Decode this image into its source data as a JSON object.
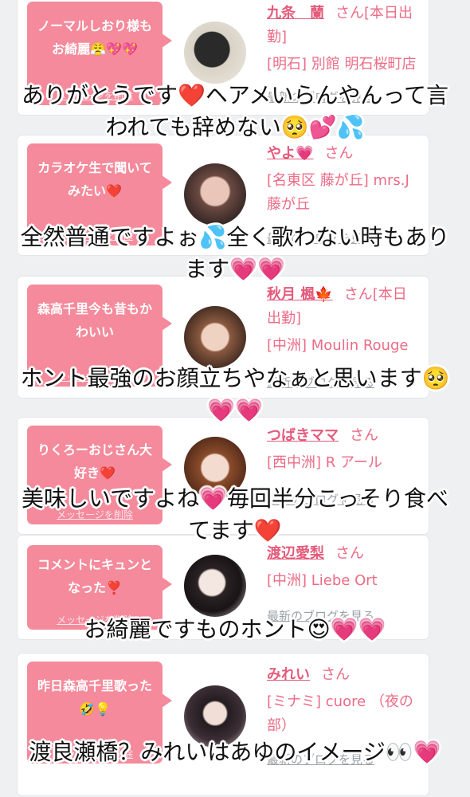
{
  "delete_label": "メッセージを削除",
  "blog_label": "最新のブログを見る",
  "san_suffix": "さん",
  "items": [
    {
      "message": "ノーマルしおり様もお綺麗😤💖💖",
      "name": "九条　蘭",
      "status": "[本日出勤]",
      "location": "[明石] 別館 明石桜町店",
      "overlay": "ありがとうです❤️ヘアメいらんやんって言われても辞めない🥺💕💦"
    },
    {
      "message": "カラオケ生で聞いてみたい❤️",
      "name": "やよ💗",
      "status": "",
      "location": "[名東区 藤が丘] mrs.J 藤が丘",
      "overlay": "全然普通ですよぉ💦全く歌わない時もあります💗💗"
    },
    {
      "message": "森高千里今も昔もかわいい",
      "name": "秋月 楓🍁",
      "status": "[本日出勤]",
      "location": "[中洲] Moulin Rouge",
      "overlay": "ホント最強のお顔立ちやなぁと思います🥺💗💗"
    },
    {
      "message": "りくろーおじさん大好き❤️",
      "name": "つばきママ",
      "status": "",
      "location": "[西中洲] R アール",
      "overlay": "美味しいですよね💗毎回半分こっそり食べてます❤️"
    },
    {
      "message": "コメントにキュンとなった❣️",
      "name": "渡辺愛梨",
      "status": "",
      "location": "[中洲] Liebe Ort",
      "overlay": "お綺麗ですものホント😍💗💗"
    },
    {
      "message": "昨日森高千里歌った🤣💡",
      "name": "みれい",
      "status": "",
      "location": "[ミナミ] cuore （夜の部）",
      "overlay": "渡良瀬橋？みれいはあゆのイメージ👀💗"
    }
  ],
  "colors": {
    "bubble": "#f48a9b",
    "accent": "#e45b7b",
    "link_gray": "#9aa0a6"
  }
}
